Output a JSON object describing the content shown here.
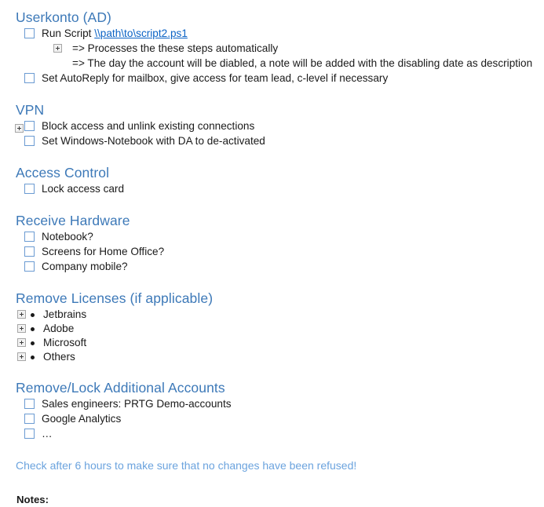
{
  "document": {
    "sections": [
      {
        "id": "userkonto",
        "heading": "Userkonto (AD)",
        "rows": [
          {
            "kind": "checkbox",
            "name": "run-script",
            "label_prefix": "Run Script ",
            "link_text": "\\\\path\\to\\script2.ps1",
            "lead_plus": false
          },
          {
            "kind": "arrow",
            "name": "processes-steps-automatically",
            "text": "=> Processes the these steps automatically",
            "plus": true
          },
          {
            "kind": "arrow",
            "name": "disabling-date-note",
            "text": "=> The day the account will be diabled, a note will be added with the disabling date as description",
            "plus": false
          },
          {
            "kind": "checkbox",
            "name": "set-autoreply",
            "label": "Set AutoReply for mailbox, give access for team lead, c-level if necessary",
            "lead_plus": false
          }
        ]
      },
      {
        "id": "vpn",
        "heading": "VPN",
        "rows": [
          {
            "kind": "checkbox",
            "name": "block-access-unlink",
            "label": "Block access and unlink existing connections",
            "lead_plus": true
          },
          {
            "kind": "checkbox",
            "name": "set-windows-notebook-da",
            "label": "Set Windows-Notebook with DA to de-activated",
            "lead_plus": false
          }
        ]
      },
      {
        "id": "access-control",
        "heading": "Access Control",
        "rows": [
          {
            "kind": "checkbox",
            "name": "lock-access-card",
            "label": "Lock access card",
            "lead_plus": false
          }
        ]
      },
      {
        "id": "receive-hardware",
        "heading": "Receive Hardware",
        "rows": [
          {
            "kind": "checkbox",
            "name": "notebook",
            "label": "Notebook?",
            "lead_plus": false
          },
          {
            "kind": "checkbox",
            "name": "screens-home-office",
            "label": "Screens for Home Office?",
            "lead_plus": false
          },
          {
            "kind": "checkbox",
            "name": "company-mobile",
            "label": "Company mobile?",
            "lead_plus": false
          }
        ]
      },
      {
        "id": "remove-licenses",
        "heading": "Remove Licenses (if applicable)",
        "rows": [
          {
            "kind": "bullet",
            "name": "license-jetbrains",
            "label": "Jetbrains",
            "plus": true
          },
          {
            "kind": "bullet",
            "name": "license-adobe",
            "label": "Adobe",
            "plus": true
          },
          {
            "kind": "bullet",
            "name": "license-microsoft",
            "label": "Microsoft",
            "plus": true
          },
          {
            "kind": "bullet",
            "name": "license-others",
            "label": "Others",
            "plus": true
          }
        ]
      },
      {
        "id": "remove-lock-additional-accounts",
        "heading": "Remove/Lock Additional Accounts",
        "rows": [
          {
            "kind": "checkbox",
            "name": "sales-engineers-prtg",
            "label": "Sales engineers: PRTG Demo-accounts",
            "lead_plus": false
          },
          {
            "kind": "checkbox",
            "name": "google-analytics",
            "label": "Google Analytics",
            "lead_plus": false
          },
          {
            "kind": "checkbox",
            "name": "ellipsis-account",
            "label": "…",
            "lead_plus": false
          }
        ]
      }
    ],
    "footer_note": "Check after 6 hours to make sure that no changes have been refused!",
    "notes_label": "Notes:"
  },
  "colors": {
    "heading_blue": "#3d79b8",
    "link_blue": "#0b63c5",
    "footer_blue": "#6ba3de",
    "checkbox_border": "#6b9bd2",
    "text": "#1a1a1a"
  },
  "icons": {
    "expand": "plus-expand-icon",
    "checkbox": "checkbox-icon",
    "bullet": "bullet-dot-icon"
  }
}
